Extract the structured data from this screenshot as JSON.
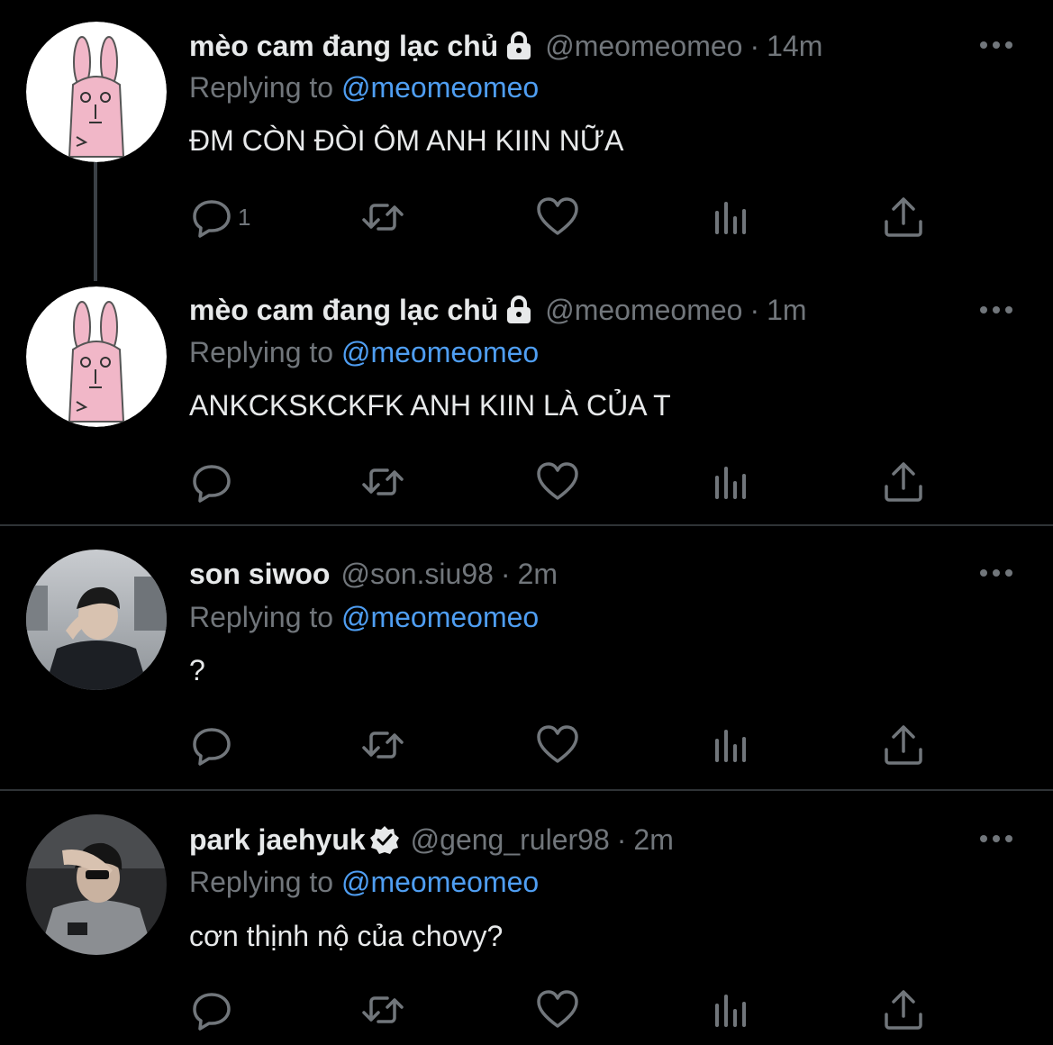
{
  "tweets": [
    {
      "name": "mèo cam đang lạc chủ",
      "badge": "lock-icon",
      "handle": "@meomeomeo",
      "sep": "·",
      "time": "14m",
      "reply_prefix": "Replying to",
      "reply_to": "@meomeomeo",
      "text": "ĐM CÒN ĐÒI ÔM ANH KIIN NỮA",
      "reply_count": "1"
    },
    {
      "name": "mèo cam đang lạc chủ",
      "badge": "lock-icon",
      "handle": "@meomeomeo",
      "sep": "·",
      "time": "1m",
      "reply_prefix": "Replying to",
      "reply_to": "@meomeomeo",
      "text": "ANKCKSKCKFK ANH KIIN LÀ CỦA T",
      "reply_count": ""
    },
    {
      "name": "son siwoo",
      "badge": "",
      "handle": "@son.siu98",
      "sep": "·",
      "time": "2m",
      "reply_prefix": "Replying to",
      "reply_to": "@meomeomeo",
      "text": "?",
      "reply_count": ""
    },
    {
      "name": "park jaehyuk",
      "badge": "verified-icon",
      "handle": "@geng_ruler98",
      "sep": "·",
      "time": "2m",
      "reply_prefix": "Replying to",
      "reply_to": "@meomeomeo",
      "text": "cơn thịnh nộ của chovy?",
      "reply_count": ""
    }
  ],
  "colors": {
    "background": "#000000",
    "text": "#e7e9ea",
    "muted": "#71767b",
    "mention": "#4f9ef2",
    "divider": "#2f3336"
  }
}
